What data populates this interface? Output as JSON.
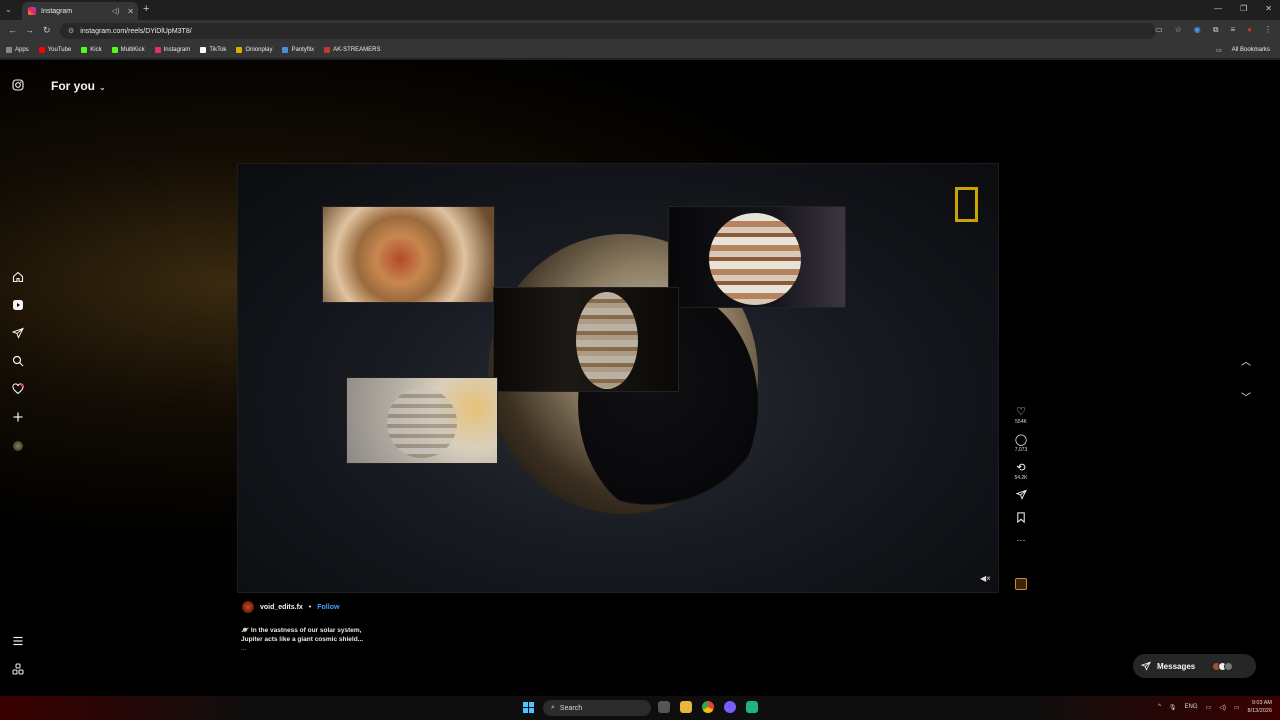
{
  "browser": {
    "tab_title": "Instagram",
    "url": "instagram.com/reels/DYiDlUpM3T8/",
    "bookmarks": [
      {
        "label": "Apps",
        "color": "#888888"
      },
      {
        "label": "YouTube",
        "color": "#ff0000"
      },
      {
        "label": "Kick",
        "color": "#53fc18"
      },
      {
        "label": "MultiKick",
        "color": "#53fc18"
      },
      {
        "label": "Instagram",
        "color": "#e1306c"
      },
      {
        "label": "TikTok",
        "color": "#ffffff"
      },
      {
        "label": "Onionplay",
        "color": "#d4b000"
      },
      {
        "label": "Pantyflix",
        "color": "#4a90d9"
      },
      {
        "label": "AK-STREAMERS",
        "color": "#c0392b"
      }
    ],
    "all_bookmarks": "All Bookmarks"
  },
  "header": {
    "feed_selector": "For you"
  },
  "sidebar": {
    "icons": [
      "instagram-logo-icon",
      "home-icon",
      "reels-icon",
      "direct-icon",
      "search-icon",
      "notifications-icon",
      "create-icon",
      "profile-avatar",
      "menu-icon",
      "more-icon"
    ]
  },
  "reel": {
    "actions": {
      "likes": "554K",
      "comments": "7,073",
      "reposts": "54.2K"
    },
    "author": {
      "username": "void_edits.fx",
      "separator": "•",
      "follow": "Follow"
    },
    "caption": {
      "line1": "🪐 In the vastness of our solar system,",
      "line2": "Jupiter acts like a giant cosmic shield...",
      "more": "..."
    }
  },
  "messages": {
    "label": "Messages"
  },
  "taskbar": {
    "search": "Search",
    "lang": "ENG",
    "time": "9:03 AM",
    "date": "8/13/2026"
  }
}
